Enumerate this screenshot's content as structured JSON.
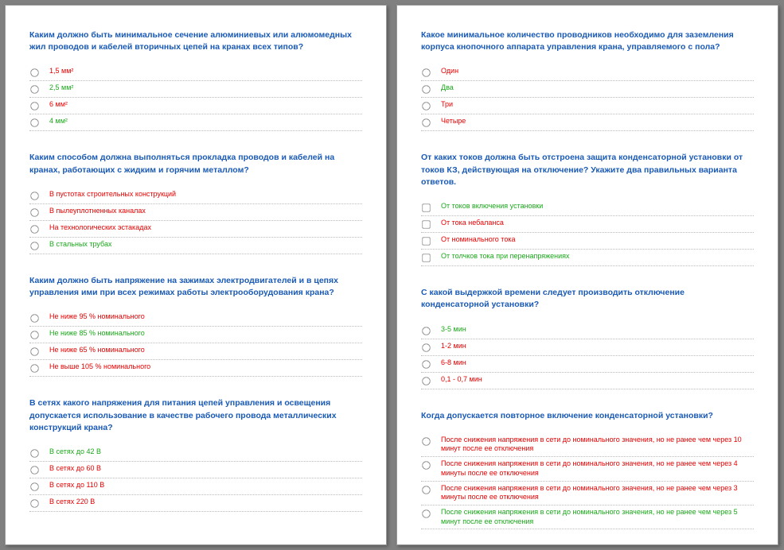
{
  "pages": [
    {
      "questions": [
        {
          "text": "Каким должно быть минимальное сечение алюминиевых или алюмомедных жил проводов и кабелей вторичных цепей на кранах всех типов?",
          "type": "radio",
          "options": [
            {
              "text": "1,5 мм²",
              "color": "red"
            },
            {
              "text": "2,5 мм²",
              "color": "green"
            },
            {
              "text": "6 мм²",
              "color": "red"
            },
            {
              "text": "4 мм²",
              "color": "green"
            }
          ]
        },
        {
          "text": "Каким способом должна выполняться прокладка проводов и кабелей на кранах, работающих с жидким и горячим металлом?",
          "type": "radio",
          "options": [
            {
              "text": "В пустотах строительных конструкций",
              "color": "red"
            },
            {
              "text": "В пылеуплотненных каналах",
              "color": "red"
            },
            {
              "text": "На технологических эстакадах",
              "color": "red"
            },
            {
              "text": "В стальных трубах",
              "color": "green"
            }
          ]
        },
        {
          "text": "Каким должно быть напряжение на зажимах электродвигателей и в цепях управления ими при всех режимах работы электрооборудования крана?",
          "type": "radio",
          "options": [
            {
              "text": "Не ниже 95 % номинального",
              "color": "red"
            },
            {
              "text": "Не ниже 85 % номинального",
              "color": "green"
            },
            {
              "text": "Не ниже 65 % номинального",
              "color": "red"
            },
            {
              "text": "Не выше 105 % номинального",
              "color": "red"
            }
          ]
        },
        {
          "text": "В сетях какого напряжения для питания цепей управления и освещения допускается использование в качестве рабочего провода металлических конструкций крана?",
          "type": "radio",
          "options": [
            {
              "text": "В сетях до 42 В",
              "color": "green"
            },
            {
              "text": "В сетях до 60 В",
              "color": "red"
            },
            {
              "text": "В сетях до 110 В",
              "color": "red"
            },
            {
              "text": "В сетях 220 В",
              "color": "red"
            }
          ]
        }
      ]
    },
    {
      "questions": [
        {
          "text": "Какое минимальное количество проводников необходимо для заземления корпуса кнопочного аппарата управления крана, управляемого с пола?",
          "type": "radio",
          "options": [
            {
              "text": "Один",
              "color": "red"
            },
            {
              "text": "Два",
              "color": "green"
            },
            {
              "text": "Три",
              "color": "red"
            },
            {
              "text": "Четыре",
              "color": "red"
            }
          ]
        },
        {
          "text": "От каких токов должна быть отстроена защита конденсаторной установки от токов КЗ, действующая на отключение? Укажите два правильных варианта ответов.",
          "type": "checkbox",
          "options": [
            {
              "text": "От токов включения установки",
              "color": "green"
            },
            {
              "text": "От тока небаланса",
              "color": "red"
            },
            {
              "text": "От номинального тока",
              "color": "red"
            },
            {
              "text": "От толчков тока при перенапряжениях",
              "color": "green"
            }
          ]
        },
        {
          "text": "С какой выдержкой времени следует производить отключение конденсаторной установки?",
          "type": "radio",
          "options": [
            {
              "text": "3-5 мин",
              "color": "green"
            },
            {
              "text": "1-2 мин",
              "color": "red"
            },
            {
              "text": "6-8 мин",
              "color": "red"
            },
            {
              "text": "0,1 - 0,7 мин",
              "color": "red"
            }
          ]
        },
        {
          "text": "Когда допускается повторное включение конденсаторной установки?",
          "type": "radio",
          "options": [
            {
              "text": "После снижения напряжения в сети до номинального значения, но не ранее чем через 10 минут после ее отключения",
              "color": "red"
            },
            {
              "text": "После снижения напряжения в сети до номинального значения, но не ранее чем через 4 минуты после ее отключения",
              "color": "red"
            },
            {
              "text": "После снижения напряжения в сети до номинального значения, но не ранее чем через 3 минуты после ее отключения",
              "color": "red"
            },
            {
              "text": "После снижения напряжения в сети до номинального значения, но не ранее чем через 5 минут после ее отключения",
              "color": "green"
            }
          ]
        }
      ]
    }
  ]
}
